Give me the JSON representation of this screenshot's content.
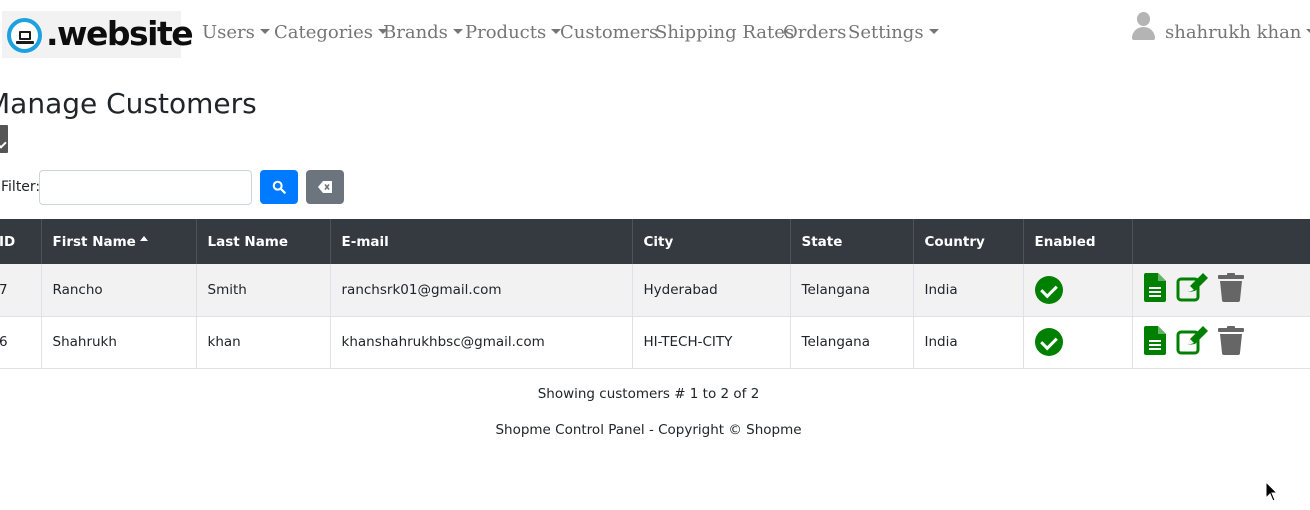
{
  "brand": {
    "logo_text": ".website"
  },
  "nav": {
    "users": "Users",
    "categories": "Categories",
    "brands": "Brands",
    "products": "Products",
    "customers": "Customers",
    "shipping": "Shipping Rates",
    "orders": "Orders",
    "settings": "Settings",
    "user_name": "shahrukh khan"
  },
  "page": {
    "title": "Manage Customers"
  },
  "filter": {
    "label": "Filter:",
    "value": "",
    "placeholder": ""
  },
  "table": {
    "headers": {
      "id": "ID",
      "first_name": "First Name",
      "last_name": "Last Name",
      "email": "E-mail",
      "city": "City",
      "state": "State",
      "country": "Country",
      "enabled": "Enabled"
    },
    "rows": [
      {
        "id": "7",
        "first_name": "Rancho",
        "last_name": "Smith",
        "email": "ranchsrk01@gmail.com",
        "city": "Hyderabad",
        "state": "Telangana",
        "country": "India",
        "enabled": true
      },
      {
        "id": "6",
        "first_name": "Shahrukh",
        "last_name": "khan",
        "email": "khanshahrukhbsc@gmail.com",
        "city": "HI-TECH-CITY",
        "state": "Telangana",
        "country": "India",
        "enabled": true
      }
    ]
  },
  "status": {
    "text": "Showing customers # 1 to 2 of 2"
  },
  "footer": {
    "text": "Shopme Control Panel - Copyright © Shopme"
  },
  "icons": {
    "details": "file-text-icon",
    "edit": "edit-icon",
    "delete": "trash-icon",
    "enabled": "check-circle-icon",
    "search": "search-icon",
    "clear": "eraser-icon",
    "export": "file-csv-icon",
    "user": "user-icon"
  },
  "colors": {
    "navbar_text": "#757575",
    "table_header_bg": "#343a40",
    "primary": "#007bff",
    "secondary": "#6c757d",
    "success": "#008000",
    "trash": "#666666"
  }
}
